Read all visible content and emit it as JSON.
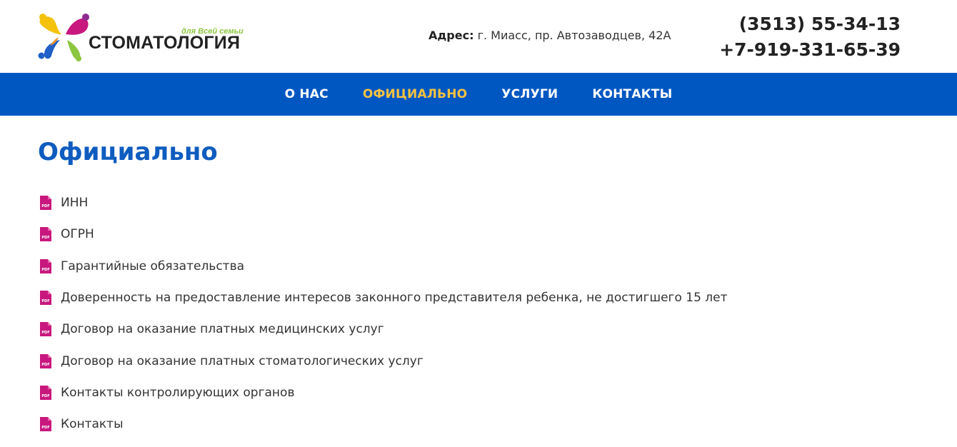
{
  "header": {
    "logo": {
      "tagline": "для Всей семьи",
      "name": "СТОМАТОЛОГИЯ",
      "icon": "butterfly-people-logo-icon"
    },
    "address": {
      "label": "Адрес:",
      "value": " г. Миасс, пр. Автозаводцев, 42А"
    },
    "phones": [
      "(3513) 55-34-13",
      "+7-919-331-65-39"
    ]
  },
  "nav": {
    "items": [
      {
        "label": "О НАС",
        "active": false
      },
      {
        "label": "ОФИЦИАЛЬНО",
        "active": true
      },
      {
        "label": "УСЛУГИ",
        "active": false
      },
      {
        "label": "КОНТАКТЫ",
        "active": false
      }
    ]
  },
  "main": {
    "title": "Официально",
    "documents": [
      {
        "label": "ИНН",
        "icon": "pdf-file-icon"
      },
      {
        "label": "ОГРН",
        "icon": "pdf-file-icon"
      },
      {
        "label": "Гарантийные обязательства",
        "icon": "pdf-file-icon"
      },
      {
        "label": "Доверенность на предоставление интересов законного представителя ребенка, не достигшего 15 лет",
        "icon": "pdf-file-icon"
      },
      {
        "label": "Договор на оказание платных медицинских услуг",
        "icon": "pdf-file-icon"
      },
      {
        "label": "Договор на оказание платных стоматологических услуг",
        "icon": "pdf-file-icon"
      },
      {
        "label": "Контакты контролирующих органов",
        "icon": "pdf-file-icon"
      },
      {
        "label": "Контакты",
        "icon": "pdf-file-icon"
      }
    ],
    "pdf_icon_text": "PDF"
  },
  "colors": {
    "nav_background": "#0057c2",
    "nav_active": "#f5c242",
    "title": "#0f5cbf",
    "pdf_icon": "#c8187e",
    "tagline": "#8cc63f"
  }
}
